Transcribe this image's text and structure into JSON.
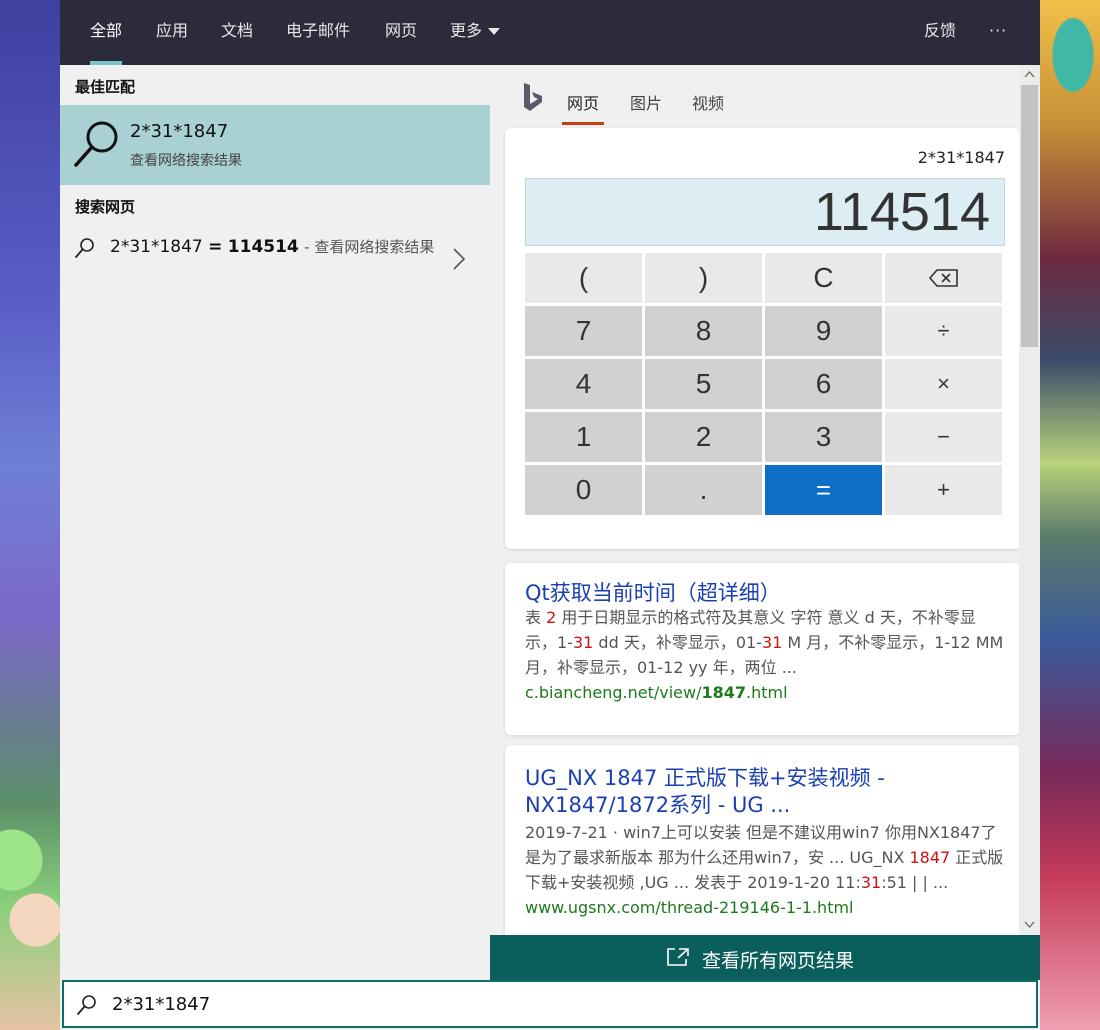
{
  "nav": {
    "tabs": [
      {
        "label": "全部",
        "active": true
      },
      {
        "label": "应用"
      },
      {
        "label": "文档"
      },
      {
        "label": "电子邮件"
      },
      {
        "label": "网页"
      },
      {
        "label": "更多"
      }
    ],
    "feedback_label": "反馈",
    "more_options_label": "···"
  },
  "left": {
    "best_match_title": "最佳匹配",
    "best_match": {
      "icon": "search-icon",
      "query": "2*31*1847",
      "subtitle": "查看网络搜索结果"
    },
    "search_web_title": "搜索网页",
    "web_result": {
      "icon": "search-icon",
      "expression": "2*31*1847",
      "equals": "=",
      "answer": "114514",
      "suffix": "- 查看网络搜索结果"
    }
  },
  "right": {
    "logo": "bing-logo",
    "tabs": [
      {
        "label": "网页",
        "active": true
      },
      {
        "label": "图片"
      },
      {
        "label": "视频"
      }
    ],
    "calculator": {
      "expression": "2*31*1847",
      "display": "114514",
      "keys": [
        {
          "label": "(",
          "style": "light"
        },
        {
          "label": ")",
          "style": "light"
        },
        {
          "label": "C",
          "style": "light"
        },
        {
          "label": "⌫",
          "style": "light",
          "icon": "backspace-icon"
        },
        {
          "label": "7",
          "style": "dark"
        },
        {
          "label": "8",
          "style": "dark"
        },
        {
          "label": "9",
          "style": "dark"
        },
        {
          "label": "÷",
          "style": "light"
        },
        {
          "label": "4",
          "style": "dark"
        },
        {
          "label": "5",
          "style": "dark"
        },
        {
          "label": "6",
          "style": "dark"
        },
        {
          "label": "×",
          "style": "light"
        },
        {
          "label": "1",
          "style": "dark"
        },
        {
          "label": "2",
          "style": "dark"
        },
        {
          "label": "3",
          "style": "dark"
        },
        {
          "label": "−",
          "style": "light"
        },
        {
          "label": "0",
          "style": "dark"
        },
        {
          "label": ".",
          "style": "dark"
        },
        {
          "label": "=",
          "style": "equals"
        },
        {
          "label": "+",
          "style": "light"
        }
      ]
    },
    "results": [
      {
        "title": "Qt获取当前时间（超详细）",
        "snippet_parts": [
          {
            "text": "表 "
          },
          {
            "text": "2",
            "hl": true
          },
          {
            "text": " 用于日期显示的格式符及其意义 字符 意义 d 天，不补零显示，1-"
          },
          {
            "text": "31",
            "hl": true
          },
          {
            "text": " dd 天，补零显示，01-"
          },
          {
            "text": "31",
            "hl": true
          },
          {
            "text": " M 月，不补零显示，1-12 MM 月，补零显示，01-12 yy 年，两位 ..."
          }
        ],
        "url_prefix": "c.biancheng.net/view/",
        "url_bold": "1847",
        "url_suffix": ".html"
      },
      {
        "title_line1": "UG_NX 1847 正式版下载+安装视频 -",
        "title_line2": "NX1847/1872系列 - UG ...",
        "snippet_parts": [
          {
            "text": "2019-7-21  ·  win7上可以安装 但是不建议用win7 你用NX1847了是为了最求新版本 那为什么还用win7，安 ... UG_NX "
          },
          {
            "text": "1847",
            "hl": true
          },
          {
            "text": " 正式版下载+安装视频 ,UG ... 发表于 2019-1-20 11:"
          },
          {
            "text": "31",
            "hl": true
          },
          {
            "text": ":51 | | ..."
          }
        ],
        "url_prefix": "www.ugsnx.com/thread-219146-1-1.html",
        "url_bold": "",
        "url_suffix": ""
      }
    ],
    "see_all_label": "查看所有网页结果"
  },
  "search": {
    "value": "2*31*1847",
    "icon": "search-icon"
  },
  "colors": {
    "topbar": "#2b2b3c",
    "accent_tab": "#7ac4c7",
    "best_match_bg": "#a9d0d3",
    "equals_key": "#0f6fc6",
    "see_all_bg": "#0a5e5b",
    "link": "#1a3fb0",
    "url": "#1b7a1b",
    "highlight": "#cc1111"
  }
}
